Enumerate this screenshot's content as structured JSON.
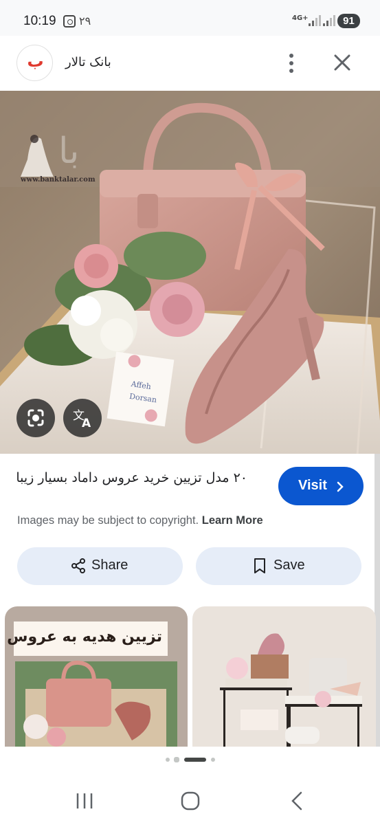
{
  "status_bar": {
    "time": "10:19",
    "date_badge": "۲۹",
    "network": "4G+",
    "battery": "91"
  },
  "app_bar": {
    "site_logo_text": "ب",
    "site_name": "بانک تالار",
    "more_icon": "more-vert-icon",
    "close_icon": "close-icon"
  },
  "hero": {
    "watermark": "www.banktalar.com",
    "card_text_1": "Affeh",
    "card_text_2": "Dorsan",
    "lens_icon": "google-lens-icon",
    "translate_icon": "translate-icon"
  },
  "result": {
    "title": "۲۰ مدل تزیین خرید عروس داماد بسیار زیبا",
    "visit_label": "Visit",
    "copyright_text": "Images may be subject to copyright.",
    "learn_more": "Learn More"
  },
  "actions": {
    "share_label": "Share",
    "save_label": "Save"
  },
  "related": {
    "card1_caption": "تزیین هدیه به عروس"
  },
  "colors": {
    "visit_bg": "#0b57d0",
    "action_bg": "#e6edf8",
    "pink_accent": "#c98f86"
  }
}
